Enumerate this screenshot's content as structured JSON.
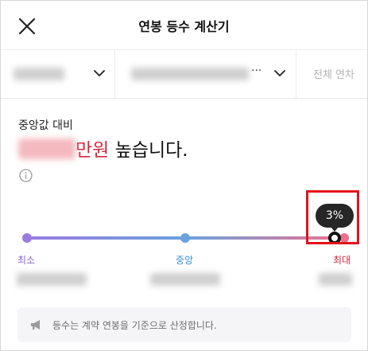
{
  "header": {
    "title": "연봉 등수 계산기",
    "close_icon": "close-icon"
  },
  "filters": {
    "items": [
      {
        "type": "dropdown",
        "value_redacted": true,
        "icon": "chevron-down-icon"
      },
      {
        "type": "dropdown",
        "value_redacted": true,
        "ellipsis": "···",
        "icon": "chevron-down-icon"
      },
      {
        "type": "button",
        "label": "전체 연차"
      }
    ]
  },
  "result": {
    "compare_label": "중앙값 대비",
    "amount_redacted": true,
    "unit": "만원",
    "suffix": " 높습니다.",
    "info_icon": "info-circle-icon"
  },
  "rank_slider": {
    "percentile_label": "3%",
    "level": 0.97,
    "ticks": [
      {
        "label": "최소",
        "color": "#8d64cf"
      },
      {
        "label": "중앙",
        "color": "#3b8fd2"
      },
      {
        "label": "최대",
        "color": "#d7263d"
      }
    ],
    "gradient": [
      "#9a7ce0",
      "#6aa2dd",
      "#ef6f8d"
    ],
    "highlight_color": "#e3141c"
  },
  "notice": {
    "icon": "megaphone-icon",
    "text": "등수는 계약 연봉을 기준으로 산정합니다."
  }
}
